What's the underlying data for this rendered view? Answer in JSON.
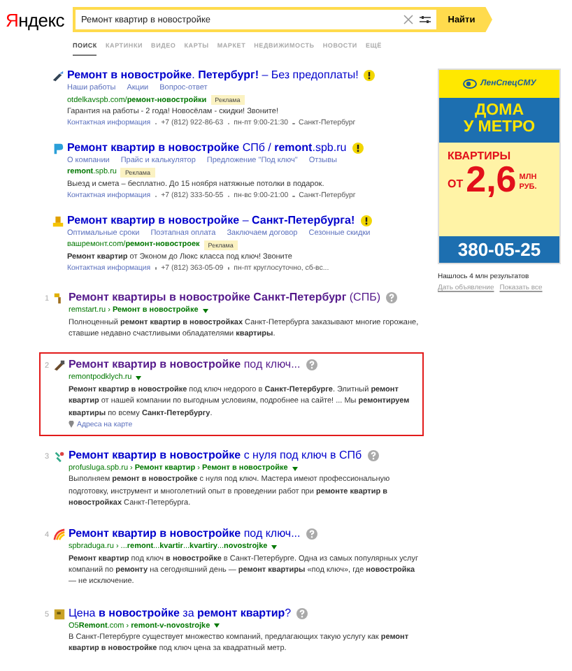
{
  "logo": "Яндекс",
  "search": {
    "value": "Ремонт квартир в новостройке",
    "button": "Найти"
  },
  "tabs": [
    {
      "label": "ПОИСК",
      "selected": true
    },
    {
      "label": "КАРТИНКИ",
      "selected": false
    },
    {
      "label": "ВИДЕО",
      "selected": false
    },
    {
      "label": "КАРТЫ",
      "selected": false
    },
    {
      "label": "МАРКЕТ",
      "selected": false
    },
    {
      "label": "НЕДВИЖИМОСТЬ",
      "selected": false
    },
    {
      "label": "НОВОСТИ",
      "selected": false
    },
    {
      "label": "ЕЩЁ",
      "selected": false
    }
  ],
  "ads": [
    {
      "title": "**Ремонт в новостройке**. **Петербург!** – Без предоплаты!",
      "sitelinks": [
        "Наши работы",
        "Акции",
        "Вопрос-ответ"
      ],
      "url": "otdelkavspb.com/**ремонт-новостройки**",
      "badge": "Реклама",
      "text": "Гарантия на работы - 2 года! Новосёлам - скидки! Звоните!",
      "contact": [
        "Контактная информация",
        "+7 (812) 922-86-63",
        "пн-пт 9:00-21:30",
        "Санкт-Петербург"
      ]
    },
    {
      "title": "**Ремонт квартир в новостройке** СПб / **remont**.spb.ru",
      "sitelinks": [
        "О компании",
        "Прайс и калькулятор",
        "Предложение \"Под ключ\"",
        "Отзывы"
      ],
      "url": "**remont**.spb.ru",
      "badge": "Реклама",
      "text": "Выезд и смета – бесплатно. До 15 ноября натяжные потолки в подарок.",
      "contact": [
        "Контактная информация",
        "+7 (812) 333-50-55",
        "пн-вс 9:00-21:00",
        "Санкт-Петербург"
      ]
    },
    {
      "title": "**Ремонт квартир в новостройке** – **Санкт-Петербурга!**",
      "sitelinks": [
        "Оптимальные сроки",
        "Поэтапная оплата",
        "Заключаем договор",
        "Сезонные скидки"
      ],
      "url": "вашремонт.com/**ремонт-новостроек**",
      "badge": "Реклама",
      "text": "**Ремонт квартир** от Эконом до Люкс класса под ключ! Звоните",
      "contact": [
        "Контактная информация",
        "+7 (812) 363-05-09",
        "пн-пт круглосуточно, сб-вс..."
      ]
    }
  ],
  "results": [
    {
      "number": "1",
      "title": "**Ремонт квартиры в новостройке Санкт-Петербург** (СПБ)",
      "visited": true,
      "highlighted": false,
      "url": "remstart.ru › **Ремонт в новостройке**",
      "snippet": "Полноценный **ремонт квартир в новостройках** Санкт-Петербурга заказывают многие горожане, ставшие недавно счастливыми обладателями **квартиры**."
    },
    {
      "number": "2",
      "title": "**Ремонт квартир в новостройке** под ключ...",
      "visited": true,
      "highlighted": true,
      "url": "remontpodklych.ru",
      "snippet": "**Ремонт квартир в новостройке** под ключ недорого в **Санкт-Петербурге**. Элитный **ремонт квартир** от нашей компании по выгодным условиям, подробнее на сайте! ... Мы **ремонтируем квартиры** по всему **Санкт-Петербургу**.",
      "map_link": "Адреса на карте"
    },
    {
      "number": "3",
      "title": "**Ремонт квартир в новостройке** с нуля под ключ в СПб",
      "visited": false,
      "highlighted": false,
      "url": "profusluga.spb.ru › **Ремонт квартир** › **Ремонт в новостройке**",
      "snippet": "Выполняем **ремонт в новостройке** с нуля под ключ. Мастера имеют профессиональную подготовку, инструмент и многолетний опыт в проведении работ при **ремонте квартир в новостройках** Санкт-Петербурга."
    },
    {
      "number": "4",
      "title": "**Ремонт квартир в новостройке** под ключ...",
      "visited": false,
      "highlighted": false,
      "url": "spbraduga.ru › ...**remont**...**kvartir**...**kvartiry**...**novostrojke**",
      "snippet": "**Ремонт квартир** под ключ **в новостройке** в Санкт-Петербурге. Одна из самых популярных услуг компаний по **ремонту** на сегодняшний день — **ремонт квартиры** «под ключ», где **новостройка** — не исключение."
    },
    {
      "number": "5",
      "title": "Цена **в новостройке** за **ремонт квартир**?",
      "visited": false,
      "highlighted": false,
      "url": "O5**Remont**.com › **remont-v-novostrojke**",
      "snippet": "В Санкт-Петербурге существует множество компаний, предлагающих такую услугу как **ремонт квартир в новостройке** под ключ цена за квадратный метр."
    }
  ],
  "banner": {
    "brand": "ЛенСпецСМУ",
    "headline": [
      "ДОМА",
      "У МЕТРО"
    ],
    "offer": "КВАРТИРЫ",
    "prefix": "ОТ",
    "price": "2,6",
    "unit": [
      "МЛН",
      "РУБ."
    ],
    "phone": "380-05-25"
  },
  "found": "Нашлось 4 млн результатов",
  "side_links": [
    "Дать объявление",
    "Показать все"
  ]
}
